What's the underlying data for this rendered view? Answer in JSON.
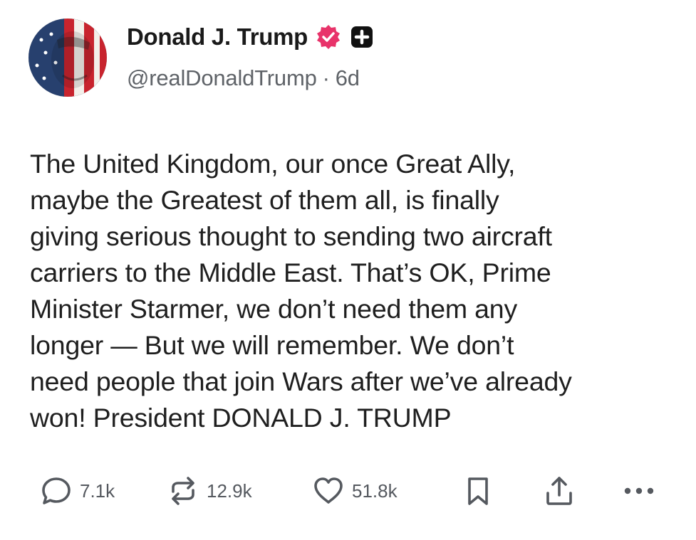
{
  "author": {
    "display_name": "Donald J. Trump",
    "handle": "@realDonaldTrump",
    "separator": "·",
    "time_ago": "6d",
    "verified_icon": "verified-badge-icon",
    "badge_icon": "plus-square-icon",
    "verified_color": "#e8336a"
  },
  "post": {
    "text": "The United Kingdom, our once Great Ally,\nmaybe the Greatest of them all, is finally\ngiving serious thought to sending two aircraft\ncarriers to the Middle East. That’s OK, Prime\nMinister Starmer, we don’t need them any\nlonger — But we will remember. We don’t\nneed people that join Wars after we’ve already\nwon! President DONALD J. TRUMP"
  },
  "actions": {
    "reply_count": "7.1k",
    "repost_count": "12.9k",
    "like_count": "51.8k",
    "icons": [
      "reply-icon",
      "repost-icon",
      "like-icon",
      "bookmark-icon",
      "share-icon",
      "more-icon"
    ]
  }
}
